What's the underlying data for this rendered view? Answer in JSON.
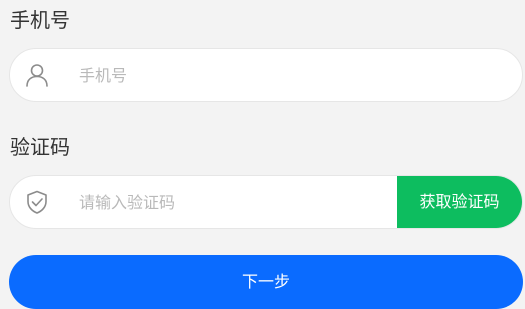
{
  "phone": {
    "label": "手机号",
    "placeholder": "手机号",
    "icon": "user-icon"
  },
  "code": {
    "label": "验证码",
    "placeholder": "请输入验证码",
    "icon": "shield-check-icon",
    "send_button_label": "获取验证码"
  },
  "next_button_label": "下一步",
  "colors": {
    "background": "#f3f3f3",
    "send_button": "#0dbd5f",
    "next_button": "#0a6bff",
    "label_text": "#333333",
    "placeholder": "#b9b9b9"
  }
}
